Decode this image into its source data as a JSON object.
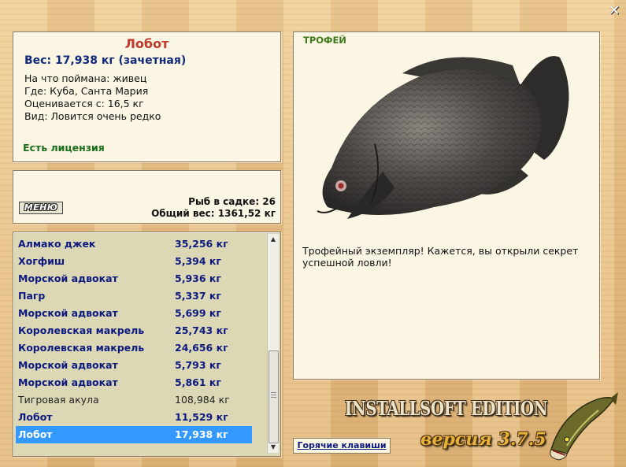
{
  "window": {
    "close_symbol": "✕"
  },
  "fish_info": {
    "name": "Лобот",
    "weight": "Вес: 17,938 кг (зачетная)",
    "caught_on": "На что поймана: живец",
    "location": "Где: Куба, Санта Мария",
    "valued_from": "Оценивается с: 16,5 кг",
    "species_note": "Вид: Ловится очень редко",
    "license": "Есть лицензия"
  },
  "keepnet": {
    "menu_label": "МЕНЮ",
    "fish_count": "Рыб в садке: 26",
    "total_weight": "Общий вес: 1361,52 кг"
  },
  "catch_list": [
    {
      "name": "Алмако джек",
      "weight": "35,256 кг",
      "style": "bold"
    },
    {
      "name": "Хогфиш",
      "weight": "5,394 кг",
      "style": "bold"
    },
    {
      "name": "Морской адвокат",
      "weight": "5,936 кг",
      "style": "bold"
    },
    {
      "name": "Пагр",
      "weight": "5,337 кг",
      "style": "bold"
    },
    {
      "name": "Морской адвокат",
      "weight": "5,699 кг",
      "style": "bold"
    },
    {
      "name": "Королевская макрель",
      "weight": "25,743 кг",
      "style": "bold"
    },
    {
      "name": "Королевская макрель",
      "weight": "24,656 кг",
      "style": "bold"
    },
    {
      "name": "Морской адвокат",
      "weight": "5,793 кг",
      "style": "bold"
    },
    {
      "name": "Морской адвокат",
      "weight": "5,861 кг",
      "style": "bold"
    },
    {
      "name": "Тигровая акула",
      "weight": "108,984 кг",
      "style": "plain"
    },
    {
      "name": "Лобот",
      "weight": "11,529 кг",
      "style": "bold"
    },
    {
      "name": "Лобот",
      "weight": "17,938 кг",
      "style": "selected"
    }
  ],
  "trophy": {
    "label": "ТРОФЕЙ",
    "text": "Трофейный экземпляр! Кажется, вы открыли секрет успешной ловли!"
  },
  "footer": {
    "hotkeys_label": "Горячие клавиши",
    "brand": "INSTALLSOFT EDITION",
    "version": "версия 3.7.5"
  },
  "colors": {
    "title_red": "#c0392b",
    "list_blue": "#0d1a80",
    "selection": "#3399ff",
    "license_green": "#1b6e1b",
    "trophy_green": "#3f7a1a"
  },
  "icons": [
    "close-icon",
    "scroll-up-icon",
    "scroll-down-icon",
    "trophy-fish-image",
    "pike-logo-icon"
  ]
}
